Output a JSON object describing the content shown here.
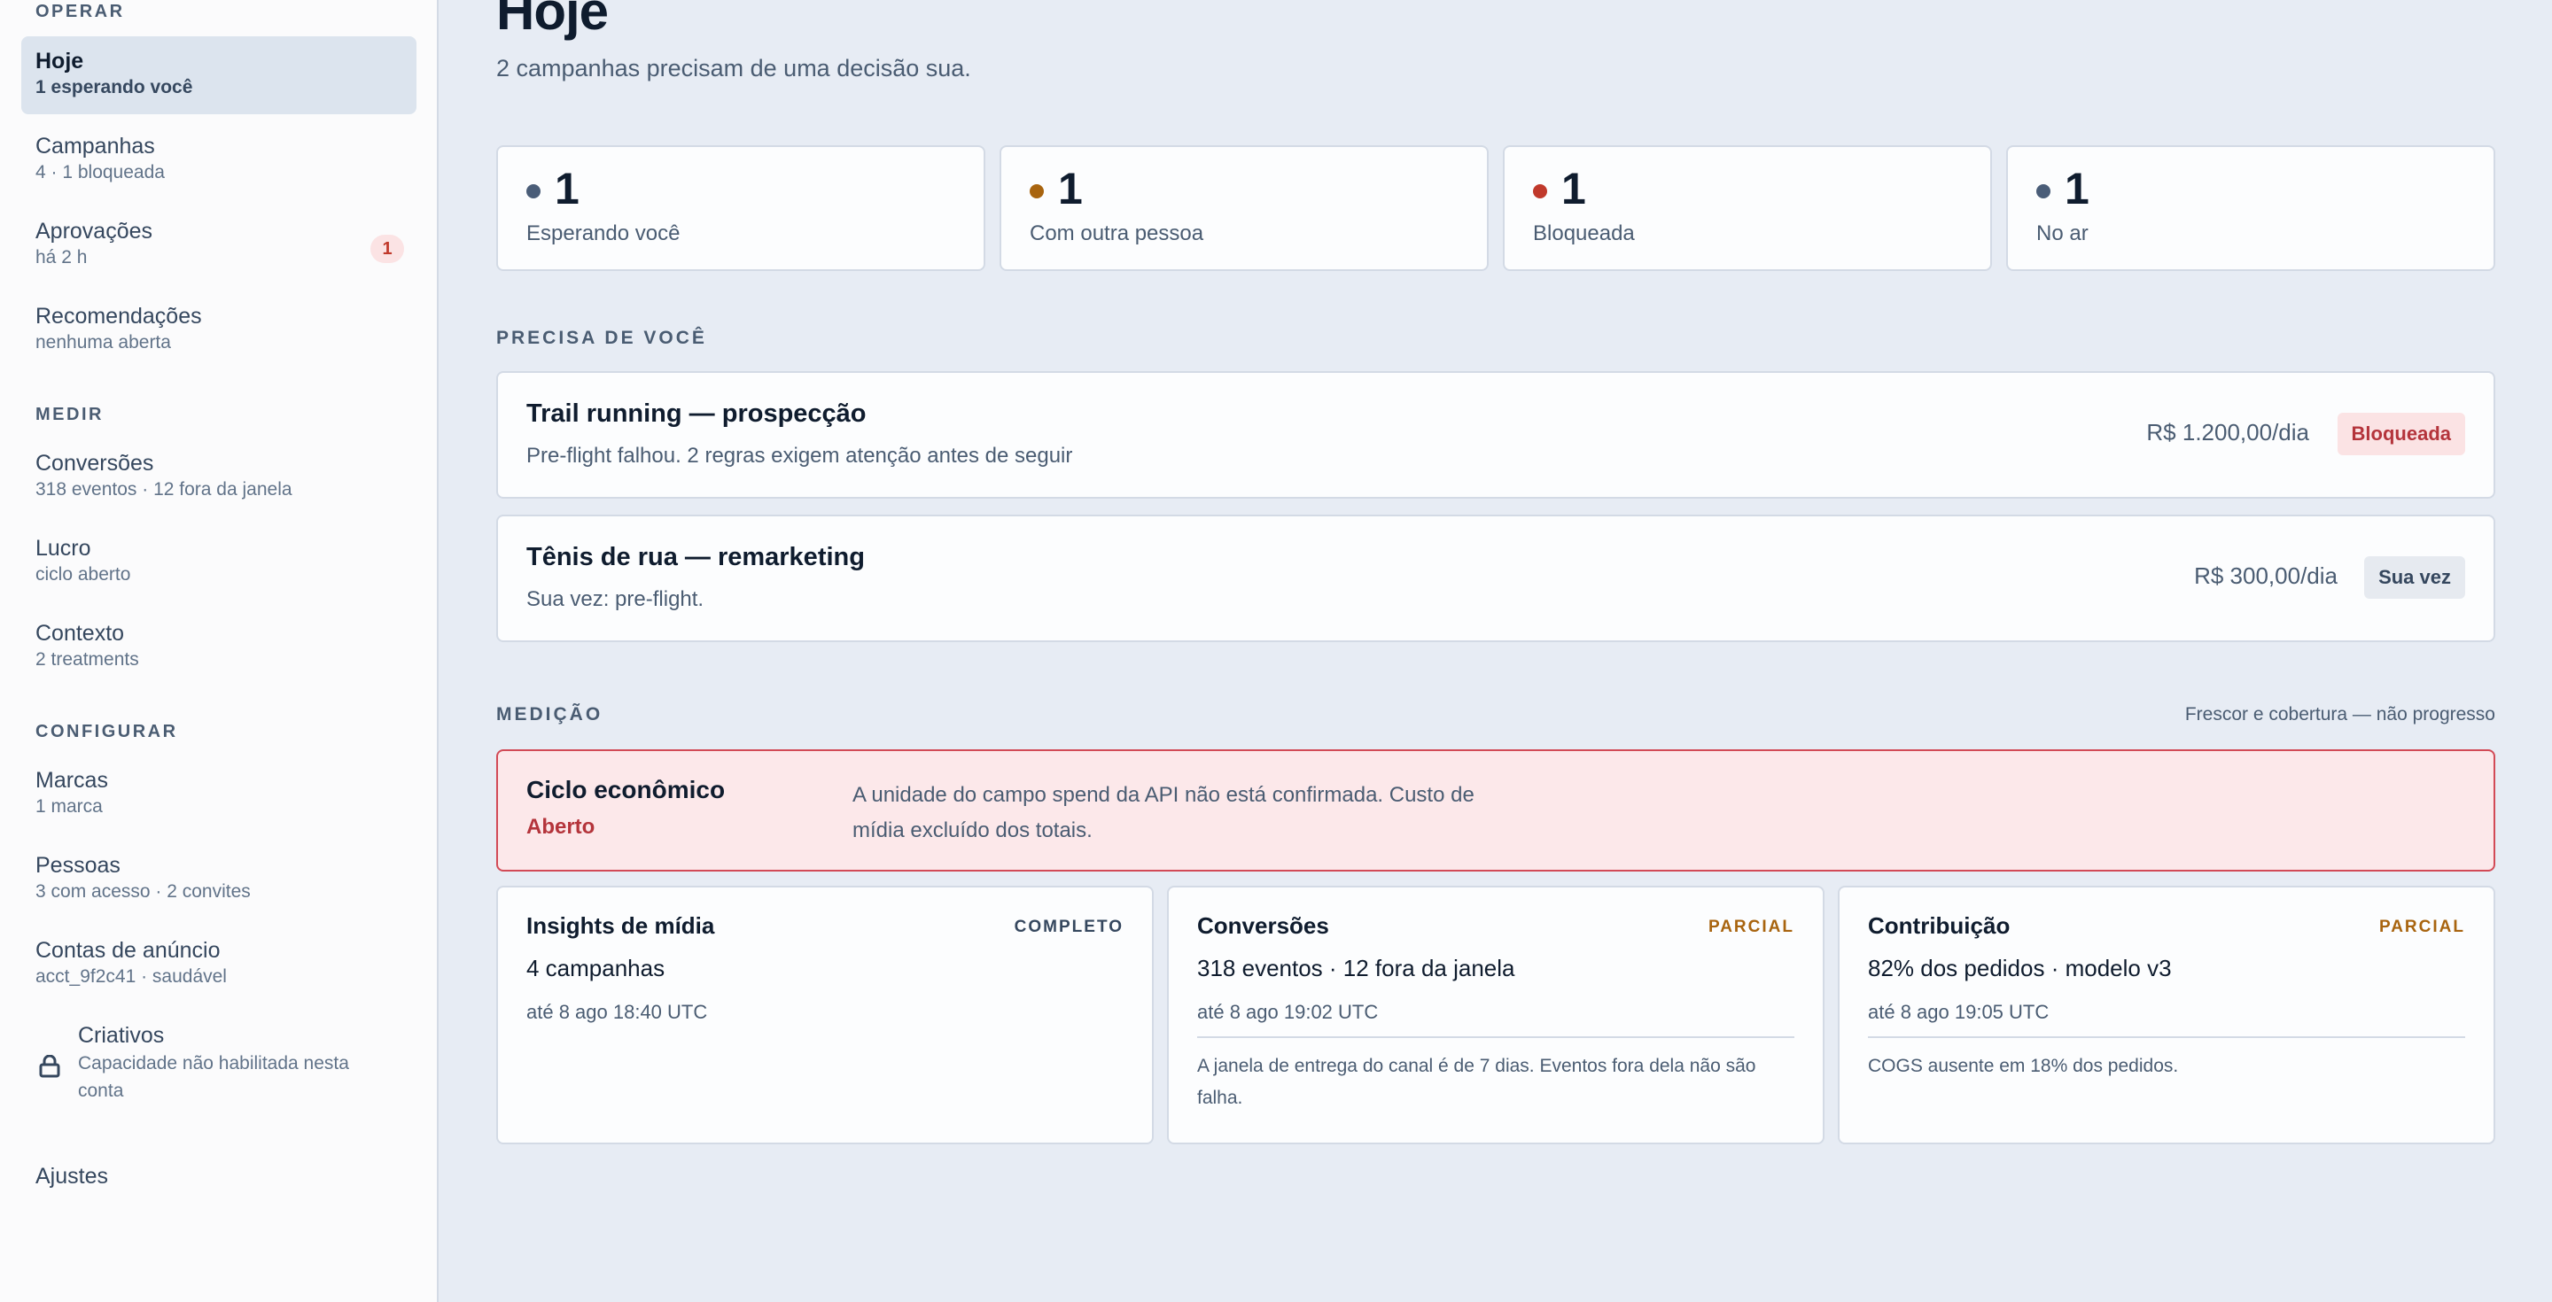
{
  "sidebar": {
    "sections": {
      "operar": "OPERAR",
      "medir": "MEDIR",
      "configurar": "CONFIGURAR"
    },
    "items": {
      "hoje": {
        "label": "Hoje",
        "sub": "1 esperando você"
      },
      "campanhas": {
        "label": "Campanhas",
        "sub": "4 · 1 bloqueada"
      },
      "aprovacoes": {
        "label": "Aprovações",
        "sub": "há 2 h",
        "badge": "1"
      },
      "recomendacoes": {
        "label": "Recomendações",
        "sub": "nenhuma aberta"
      },
      "conversoes": {
        "label": "Conversões",
        "sub": "318 eventos · 12 fora da janela"
      },
      "lucro": {
        "label": "Lucro",
        "sub": "ciclo aberto"
      },
      "contexto": {
        "label": "Contexto",
        "sub": "2 treatments"
      },
      "marcas": {
        "label": "Marcas",
        "sub": "1 marca"
      },
      "pessoas": {
        "label": "Pessoas",
        "sub": "3 com acesso · 2 convites"
      },
      "contas": {
        "label": "Contas de anúncio",
        "sub": "acct_9f2c41 · saudável"
      },
      "criativos": {
        "label": "Criativos",
        "sub": "Capacidade não habilitada nesta conta",
        "icon": "lock-icon"
      },
      "ajustes": {
        "label": "Ajustes"
      }
    }
  },
  "header": {
    "title": "Hoje",
    "subtitle": "2 campanhas precisam de uma decisão sua."
  },
  "stats": [
    {
      "value": "1",
      "label": "Esperando você",
      "color": "#4a5d78"
    },
    {
      "value": "1",
      "label": "Com outra pessoa",
      "color": "#a8640f"
    },
    {
      "value": "1",
      "label": "Bloqueada",
      "color": "#c0392b"
    },
    {
      "value": "1",
      "label": "No ar",
      "color": "#4a5d78"
    }
  ],
  "needs_you": {
    "label": "PRECISA DE VOCÊ",
    "campaigns": [
      {
        "name": "Trail running — prospecção",
        "desc": "Pre-flight falhou. 2 regras exigem atenção antes de seguir",
        "budget": "R$ 1.200,00/dia",
        "status": "Bloqueada"
      },
      {
        "name": "Tênis de rua — remarketing",
        "desc": "Sua vez: pre-flight.",
        "budget": "R$ 300,00/dia",
        "status": "Sua vez"
      }
    ]
  },
  "measurement": {
    "label": "MEDIÇÃO",
    "note": "Frescor e cobertura — não progresso",
    "alert": {
      "title": "Ciclo econômico",
      "state": "Aberto",
      "text": "A unidade do campo spend da API não está confirmada. Custo de mídia excluído dos totais."
    },
    "cards": [
      {
        "title": "Insights de mídia",
        "tag": "COMPLETO",
        "value": "4 campanhas",
        "time": "até 8 ago 18:40 UTC",
        "note": ""
      },
      {
        "title": "Conversões",
        "tag": "PARCIAL",
        "value": "318 eventos · 12 fora da janela",
        "time": "até 8 ago 19:02 UTC",
        "note": "A janela de entrega do canal é de 7 dias. Eventos fora dela não são falha."
      },
      {
        "title": "Contribuição",
        "tag": "PARCIAL",
        "value": "82% dos pedidos · modelo v3",
        "time": "até 8 ago 19:05 UTC",
        "note": "COGS ausente em 18% dos pedidos."
      }
    ]
  }
}
